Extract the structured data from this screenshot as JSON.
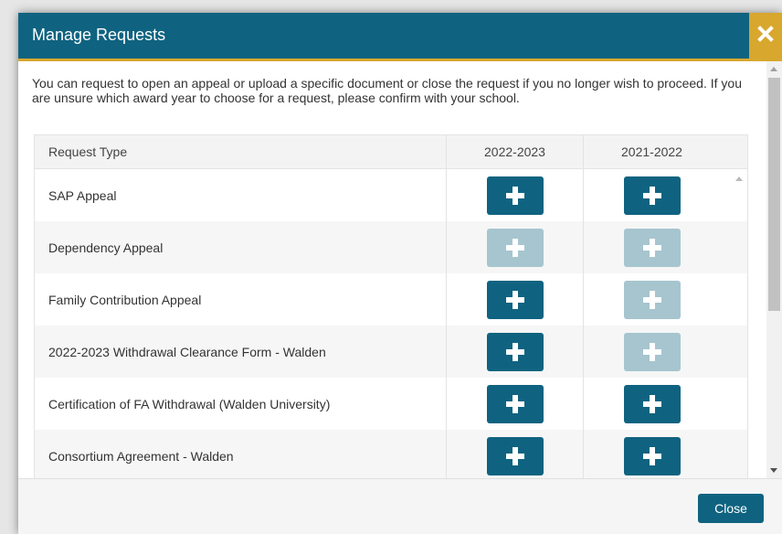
{
  "modal": {
    "title": "Manage Requests",
    "close_icon": "close-x-icon",
    "intro": "You can request to open an appeal or upload a specific document or close the request if you no longer wish to proceed. If you are unsure which award year to choose for a request, please confirm with your school."
  },
  "table": {
    "headers": [
      "Request Type",
      "2022-2023",
      "2021-2022"
    ],
    "rows": [
      {
        "label": "SAP Appeal",
        "y2022_2023": "enabled",
        "y2021_2022": "enabled"
      },
      {
        "label": "Dependency Appeal",
        "y2022_2023": "disabled",
        "y2021_2022": "disabled"
      },
      {
        "label": "Family Contribution Appeal",
        "y2022_2023": "enabled",
        "y2021_2022": "disabled"
      },
      {
        "label": "2022-2023 Withdrawal Clearance Form - Walden",
        "y2022_2023": "enabled",
        "y2021_2022": "disabled"
      },
      {
        "label": "Certification of FA Withdrawal (Walden University)",
        "y2022_2023": "enabled",
        "y2021_2022": "enabled"
      },
      {
        "label": "Consortium Agreement - Walden",
        "y2022_2023": "enabled",
        "y2021_2022": "enabled"
      }
    ],
    "add_icon": "plus-icon"
  },
  "footer": {
    "close_label": "Close"
  },
  "colors": {
    "header": "#0f6380",
    "accent": "#d8a72d",
    "button": "#0f6380",
    "button_disabled": "#a6c5cf"
  }
}
